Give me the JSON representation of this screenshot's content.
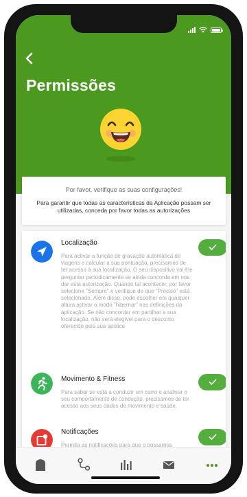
{
  "header": {
    "title": "Permissões"
  },
  "info_card": {
    "heading": "Por favor, verifique as suas configurações!",
    "body": "Para garantir que todas as características da Aplicação possam ser utilizadas, conceda por favor todas as autorizações"
  },
  "permissions": [
    {
      "title": "Localização",
      "description": "Para activar a função de gravação automática de viagens e calcular a sua pontuação, precisamos de ter acesso à sua localização. O seu dispositivo vai-lhe perguntar periodicamente se ainda concorda em nos dar esta autorização. Quando tal acontecer, por favor selecione \"Sempre\" e verifique de que \"Preciso\" está selecionado.  Além disso, pode escolher em qualquer altura activar o modo \"hibernar\" nas definições da aplicação. Se não concordar em partilhar a sua localização, não será elegível para o desconto oferecido pela sua apólice",
      "icon": "location-arrow-icon",
      "color": "#1a73e8",
      "enabled": true
    },
    {
      "title": "Movimento & Fitness",
      "description": "Para saber se está a conduzir um carro e analisar o seu comportamento de condução, precisamos de ter acesso aos seus dados de movimento e saúde.",
      "icon": "running-person-icon",
      "color": "#3cb55a",
      "enabled": true
    },
    {
      "title": "Notificações",
      "description": "Permita as notificações para que o possamos informar caso receba uma nova mensagem",
      "icon": "notification-badge-icon",
      "color": "#e53935",
      "enabled": true
    }
  ],
  "tabbar": {
    "items": [
      "home-icon",
      "route-icon",
      "stats-icon",
      "mail-icon",
      "more-icon"
    ],
    "active_color": "#4b9a1f"
  },
  "colors": {
    "header_green": "#4b9a1f",
    "toggle_green": "#54ae3e"
  }
}
